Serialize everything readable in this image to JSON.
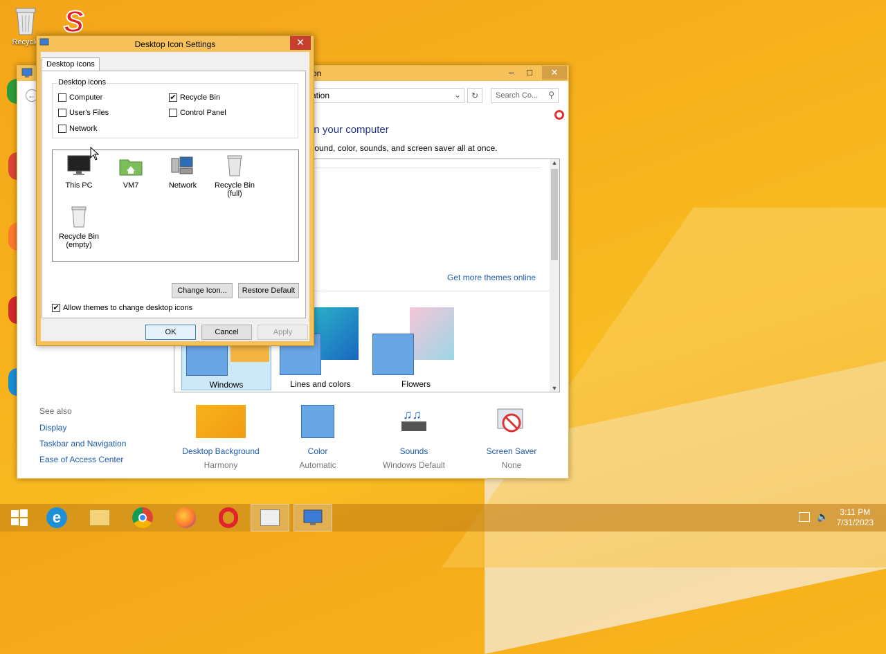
{
  "desktop": {
    "icons": [
      {
        "label": "Recycle"
      }
    ]
  },
  "control_panel": {
    "title_fragment": "on",
    "address_fragment": "alization",
    "search_placeholder": "Search Co...",
    "heading_fragment": "ds on your computer",
    "subtitle_fragment": "ackground, color, sounds, and screen saver all at once.",
    "get_more_themes": "Get more themes online",
    "themes": [
      {
        "label": "Windows"
      },
      {
        "label": "Lines and colors"
      },
      {
        "label": "Flowers"
      }
    ],
    "see_also": {
      "heading": "See also",
      "links": [
        "Display",
        "Taskbar and Navigation",
        "Ease of Access Center"
      ]
    },
    "bottom_items": [
      {
        "name": "Desktop Background",
        "value": "Harmony"
      },
      {
        "name": "Color",
        "value": "Automatic"
      },
      {
        "name": "Sounds",
        "value": "Windows Default"
      },
      {
        "name": "Screen Saver",
        "value": "None"
      }
    ]
  },
  "dialog": {
    "title": "Desktop Icon Settings",
    "tab": "Desktop Icons",
    "group_label": "Desktop icons",
    "checkboxes": {
      "computer": {
        "label": "Computer",
        "checked": false
      },
      "users_files": {
        "label": "User's Files",
        "checked": false
      },
      "network": {
        "label": "Network",
        "checked": false
      },
      "recycle_bin": {
        "label": "Recycle Bin",
        "checked": true
      },
      "control_panel": {
        "label": "Control Panel",
        "checked": false
      }
    },
    "icons": [
      {
        "label": "This PC"
      },
      {
        "label": "VM7"
      },
      {
        "label": "Network"
      },
      {
        "label": "Recycle Bin (full)"
      },
      {
        "label": "Recycle Bin (empty)"
      }
    ],
    "change_icon": "Change Icon...",
    "restore_default": "Restore Default",
    "allow_themes": {
      "label": "Allow themes to change desktop icons",
      "checked": true
    },
    "ok": "OK",
    "cancel": "Cancel",
    "apply": "Apply"
  },
  "taskbar": {
    "time": "3:11 PM",
    "date": "7/31/2023"
  },
  "colors": {
    "accent_title": "#f5c158",
    "link": "#1c5bb0",
    "close_red": "#c7402f"
  }
}
